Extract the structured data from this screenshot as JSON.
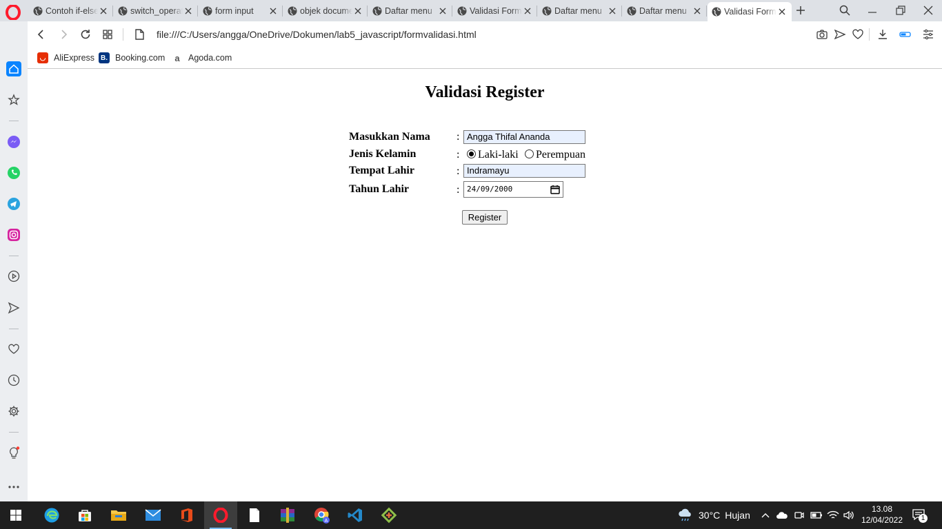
{
  "browser": {
    "tabs": [
      {
        "title": "Contoh if-else",
        "active": false
      },
      {
        "title": "switch_operator",
        "active": false
      },
      {
        "title": "form input",
        "active": false
      },
      {
        "title": "objek document",
        "active": false
      },
      {
        "title": "Daftar menu",
        "active": false
      },
      {
        "title": "Validasi Form",
        "active": false
      },
      {
        "title": "Daftar menu",
        "active": false
      },
      {
        "title": "Daftar menu",
        "active": false
      },
      {
        "title": "Validasi Form",
        "active": true
      }
    ],
    "url": "file:///C:/Users/angga/OneDrive/Dokumen/lab5_javascript/formvalidasi.html",
    "bookmarks": [
      {
        "label": "AliExpress",
        "icon": "aliexpress-icon",
        "color": "#e62e04"
      },
      {
        "label": "Booking.com",
        "icon": "booking-icon",
        "color": "#003580"
      },
      {
        "label": "Agoda.com",
        "icon": "agoda-icon",
        "color": "#ffffff"
      }
    ],
    "accent": "#0a84ff"
  },
  "form": {
    "title": "Validasi Register",
    "name_label": "Masukkan Nama",
    "name_value": "Angga Thifal Ananda",
    "gender_label": "Jenis Kelamin",
    "gender_options": [
      "Laki-laki",
      "Perempuan"
    ],
    "gender_selected": "Laki-laki",
    "place_label": "Tempat Lahir",
    "place_value": "Indramayu",
    "year_label": "Tahun Lahir",
    "date_value": "24/09/2000",
    "colon": ":",
    "submit_label": "Register"
  },
  "taskbar": {
    "weather_temp": "30°C",
    "weather_text": "Hujan",
    "time": "13.08",
    "date": "12/04/2022",
    "notifications": "1"
  }
}
